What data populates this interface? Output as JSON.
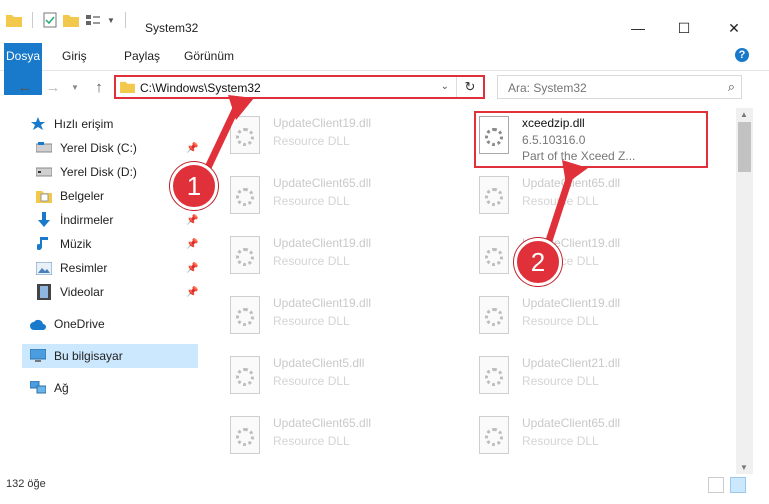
{
  "window": {
    "title": "System32",
    "minimize_label": "—",
    "maximize_label": "☐",
    "close_label": "✕"
  },
  "ribbon": {
    "tabs": [
      "Dosya",
      "Giriş",
      "Paylaş",
      "Görünüm"
    ],
    "help_label": "?"
  },
  "navigation": {
    "address": "C:\\Windows\\System32",
    "search_placeholder": "Ara: System32"
  },
  "sidebar": {
    "items": [
      {
        "label": "Hızlı erişim",
        "icon": "star-icon"
      },
      {
        "label": "Yerel Disk (C:)",
        "icon": "drive-icon"
      },
      {
        "label": "Yerel Disk (D:)",
        "icon": "drive-icon"
      },
      {
        "label": "Belgeler",
        "icon": "folder-icon"
      },
      {
        "label": "İndirmeler",
        "icon": "download-icon"
      },
      {
        "label": "Müzik",
        "icon": "music-icon"
      },
      {
        "label": "Resimler",
        "icon": "pictures-icon"
      },
      {
        "label": "Videolar",
        "icon": "video-icon"
      },
      {
        "label": "OneDrive",
        "icon": "cloud-icon"
      },
      {
        "label": "Bu bilgisayar",
        "icon": "computer-icon"
      },
      {
        "label": "Ağ",
        "icon": "network-icon"
      }
    ]
  },
  "files": {
    "left": [
      {
        "name": "UpdateClient19.dll",
        "desc": "Resource DLL"
      },
      {
        "name": "UpdateClient65.dll",
        "desc": "Resource DLL"
      },
      {
        "name": "UpdateClient19.dll",
        "desc": "Resource DLL"
      },
      {
        "name": "UpdateClient19.dll",
        "desc": "Resource DLL"
      },
      {
        "name": "UpdateClient5.dll",
        "desc": "Resource DLL"
      },
      {
        "name": "UpdateClient65.dll",
        "desc": "Resource DLL"
      }
    ],
    "right": [
      {
        "name": "xceedzip.dll",
        "version": "6.5.10316.0",
        "desc": "Part of the Xceed Z..."
      },
      {
        "name": "UpdateClient65.dll",
        "desc": "Resource DLL"
      },
      {
        "name": "UpdateClient19.dll",
        "desc": "Resource DLL"
      },
      {
        "name": "UpdateClient19.dll",
        "desc": "Resource DLL"
      },
      {
        "name": "UpdateClient21.dll",
        "desc": "Resource DLL"
      },
      {
        "name": "UpdateClient65.dll",
        "desc": "Resource DLL"
      }
    ]
  },
  "status": {
    "item_count": "132 öğe"
  },
  "annotations": {
    "callout_1": "1",
    "callout_2": "2",
    "color": "#e03039"
  }
}
